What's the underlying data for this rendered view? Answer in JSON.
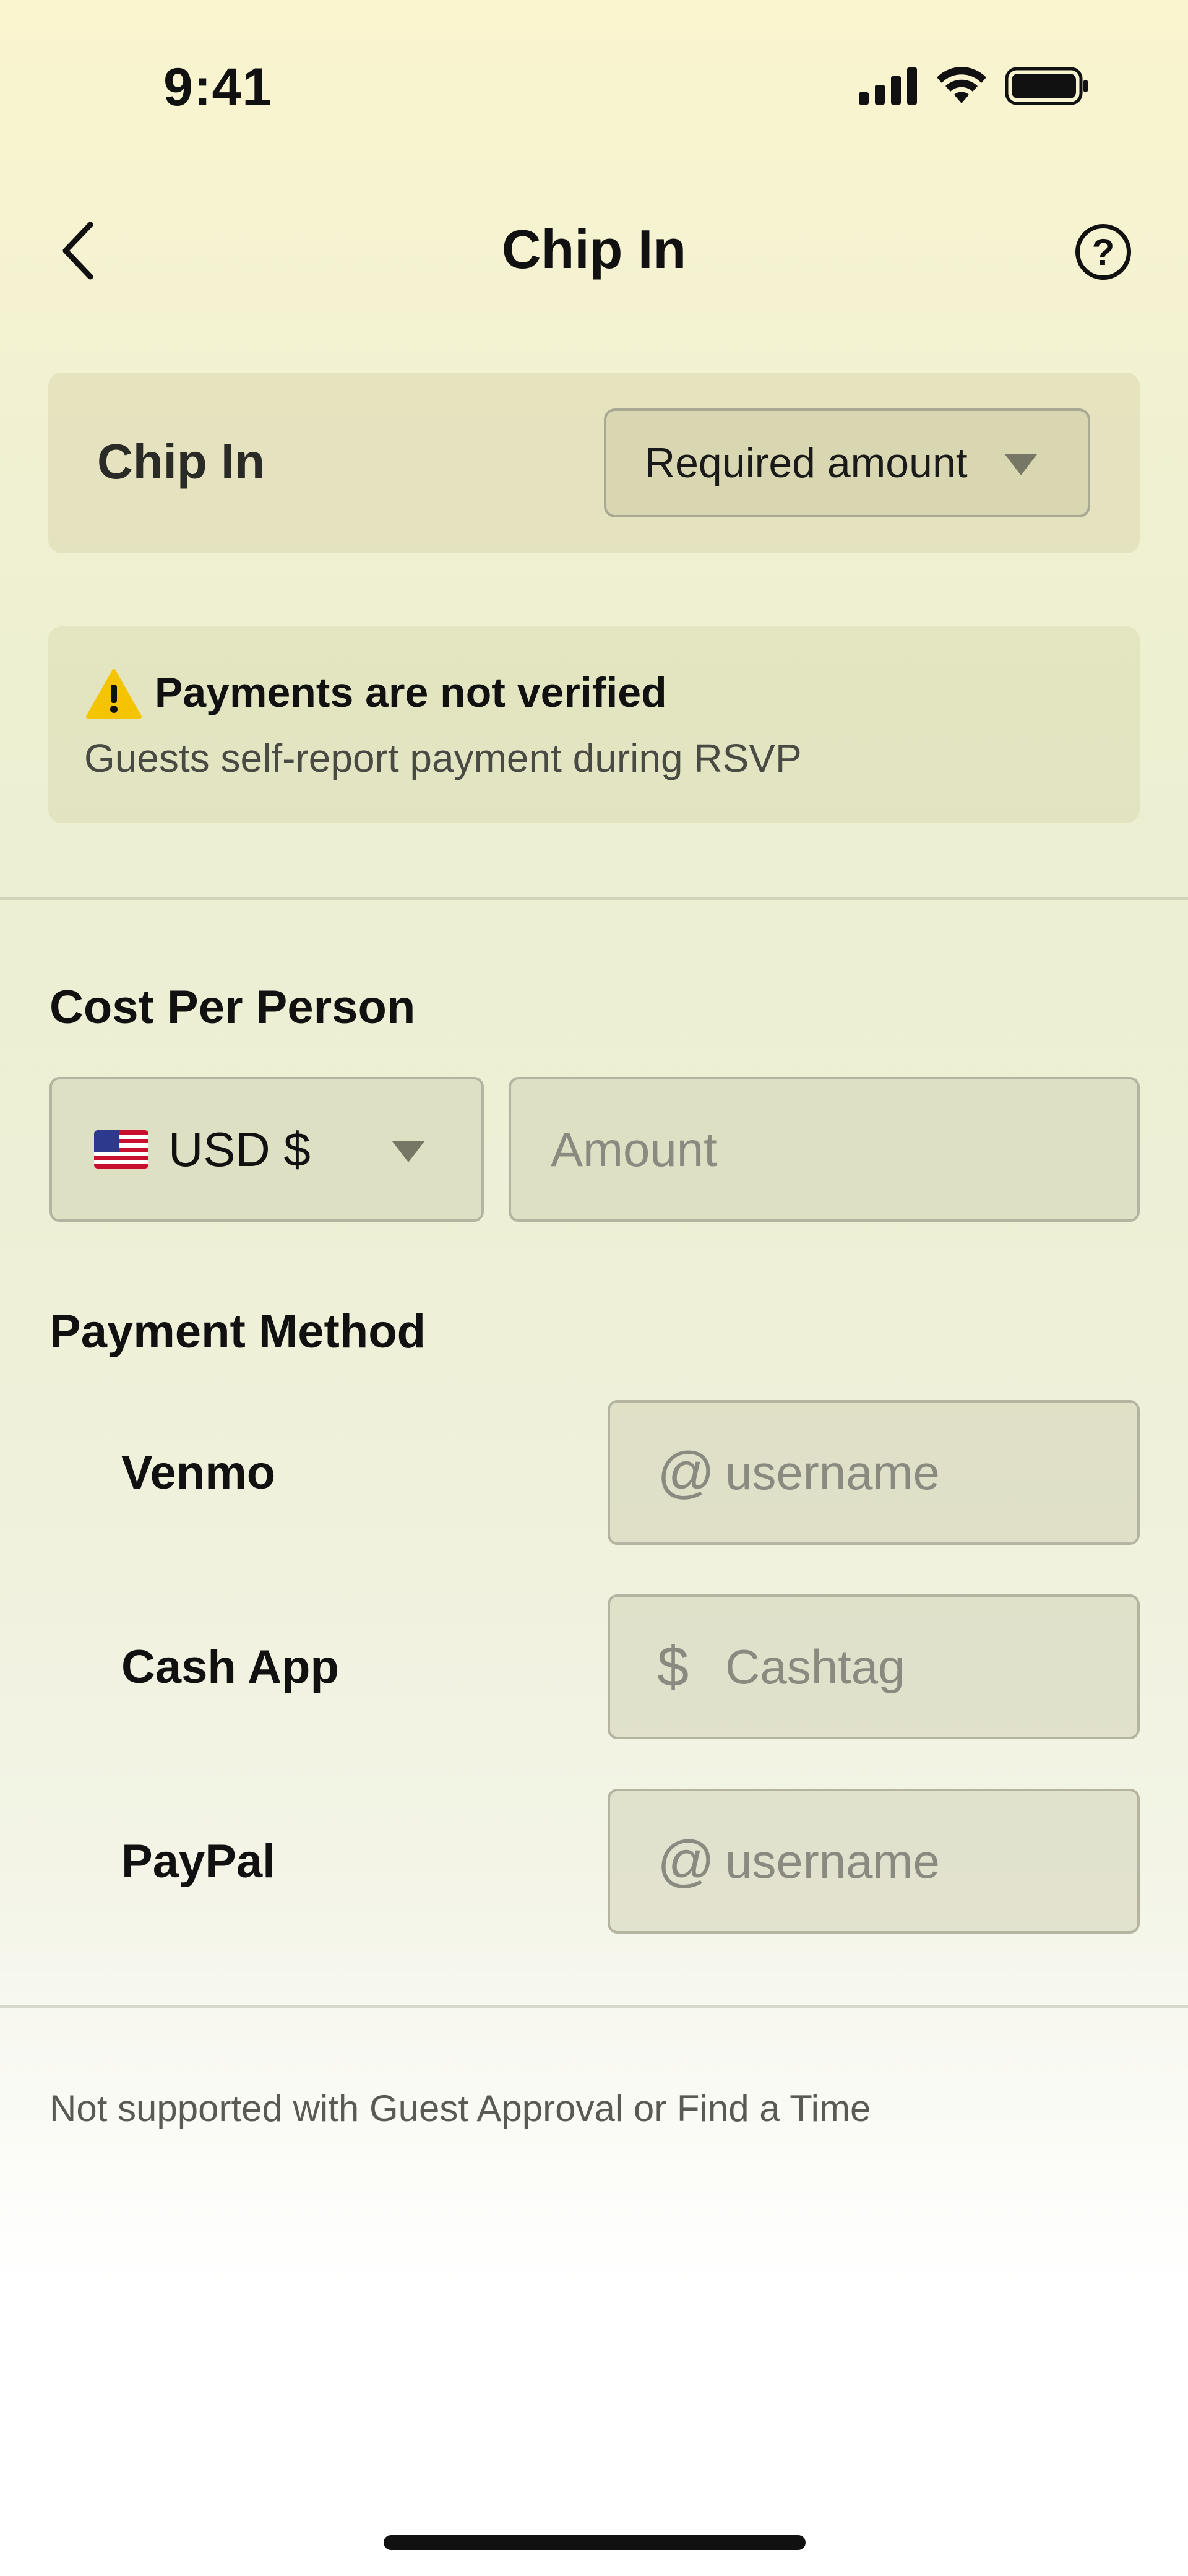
{
  "status_bar": {
    "time": "9:41",
    "icons": [
      "signal-icon",
      "wifi-icon",
      "battery-icon"
    ]
  },
  "nav": {
    "title": "Chip In",
    "back_icon": "chevron-left-icon",
    "help_icon": "question-circle-icon",
    "help_glyph": "?"
  },
  "chip_in": {
    "label": "Chip In",
    "selected_option": "Required amount"
  },
  "warning": {
    "icon": "warning-icon",
    "title": "Payments are not verified",
    "subtitle": "Guests self-report payment during RSVP"
  },
  "cost_per_person": {
    "heading": "Cost Per Person",
    "currency": "USD $",
    "currency_flag": "us-flag-icon",
    "amount_placeholder": "Amount"
  },
  "payment_method": {
    "heading": "Payment Method",
    "methods": [
      {
        "label": "Venmo",
        "prefix": "@",
        "placeholder": "username"
      },
      {
        "label": "Cash App",
        "prefix": "$",
        "placeholder": "Cashtag"
      },
      {
        "label": "PayPal",
        "prefix": "@",
        "placeholder": "username"
      }
    ]
  },
  "footnote": "Not supported with Guest Approval or Find a Time",
  "colors": {
    "background_top": "#faf5cf",
    "text_primary": "#111111",
    "warning_yellow": "#f5c400"
  }
}
